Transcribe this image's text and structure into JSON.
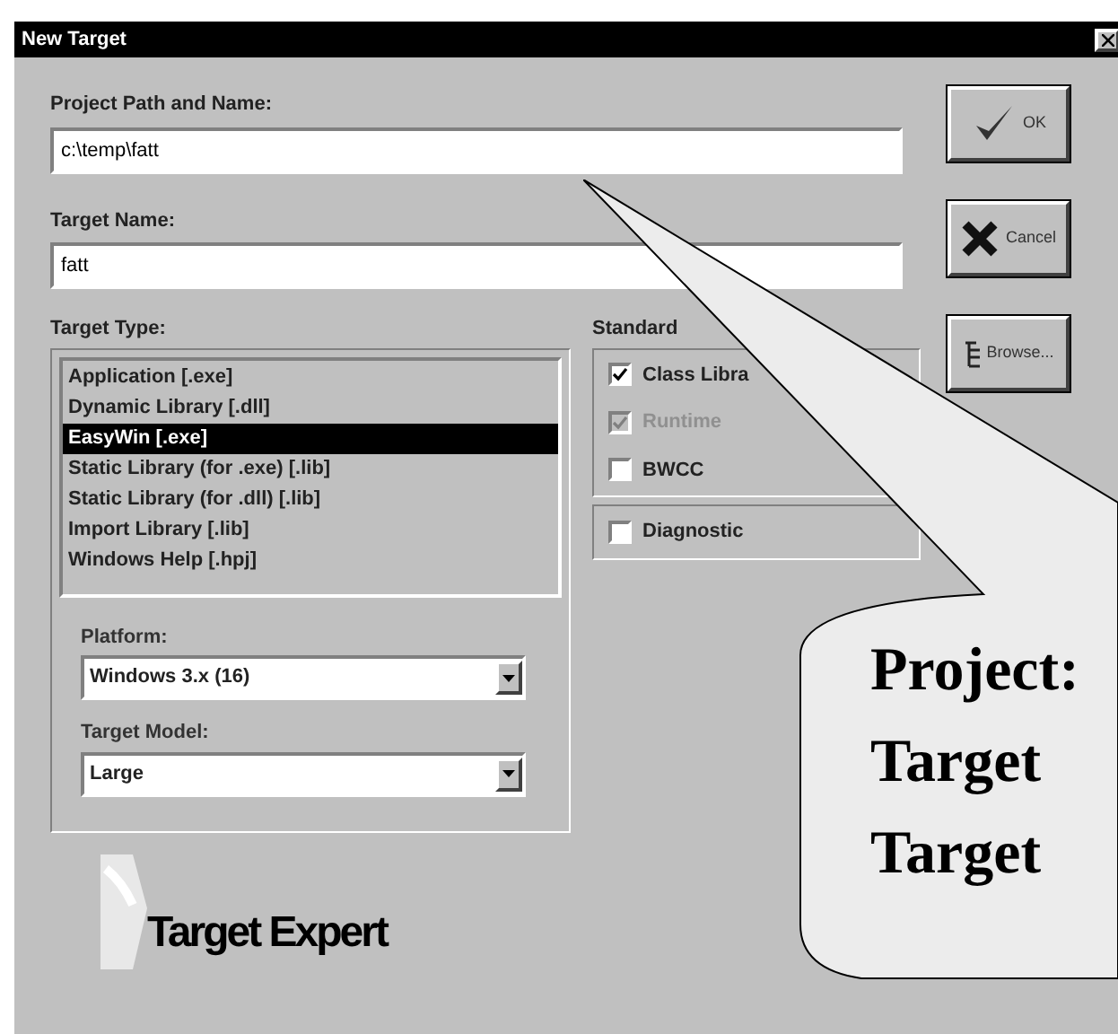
{
  "window": {
    "title": "New Target"
  },
  "project_path": {
    "label": "Project Path and Name:",
    "value": "c:\\temp\\fatt"
  },
  "target_name": {
    "label": "Target Name:",
    "value": "fatt"
  },
  "target_type": {
    "label": "Target Type:",
    "items": [
      {
        "label": "Application [.exe]",
        "selected": false
      },
      {
        "label": "Dynamic Library [.dll]",
        "selected": false
      },
      {
        "label": "EasyWin [.exe]",
        "selected": true
      },
      {
        "label": "Static Library (for .exe) [.lib]",
        "selected": false
      },
      {
        "label": "Static Library (for .dll) [.lib]",
        "selected": false
      },
      {
        "label": "Import Library [.lib]",
        "selected": false
      },
      {
        "label": "Windows Help [.hpj]",
        "selected": false
      }
    ]
  },
  "platform": {
    "label": "Platform:",
    "value": "Windows 3.x (16)"
  },
  "target_model": {
    "label": "Target Model:",
    "value": "Large"
  },
  "standard_libraries": {
    "label": "Standard",
    "items": [
      {
        "label": "Class Libra",
        "checked": true,
        "disabled": false
      },
      {
        "label": "Runtime",
        "checked": true,
        "disabled": true
      },
      {
        "label": "BWCC",
        "checked": false,
        "disabled": false
      }
    ]
  },
  "diagnostic": {
    "label": "Diagnostic",
    "checked": false
  },
  "buttons": [
    {
      "kind": "ok",
      "label": "OK"
    },
    {
      "kind": "cancel",
      "label": "Cancel"
    },
    {
      "kind": "browse",
      "label": "Browse..."
    }
  ],
  "logo": {
    "text": "Target Expert"
  },
  "callout": {
    "lines": [
      "Project:",
      "Target",
      "Target"
    ]
  }
}
